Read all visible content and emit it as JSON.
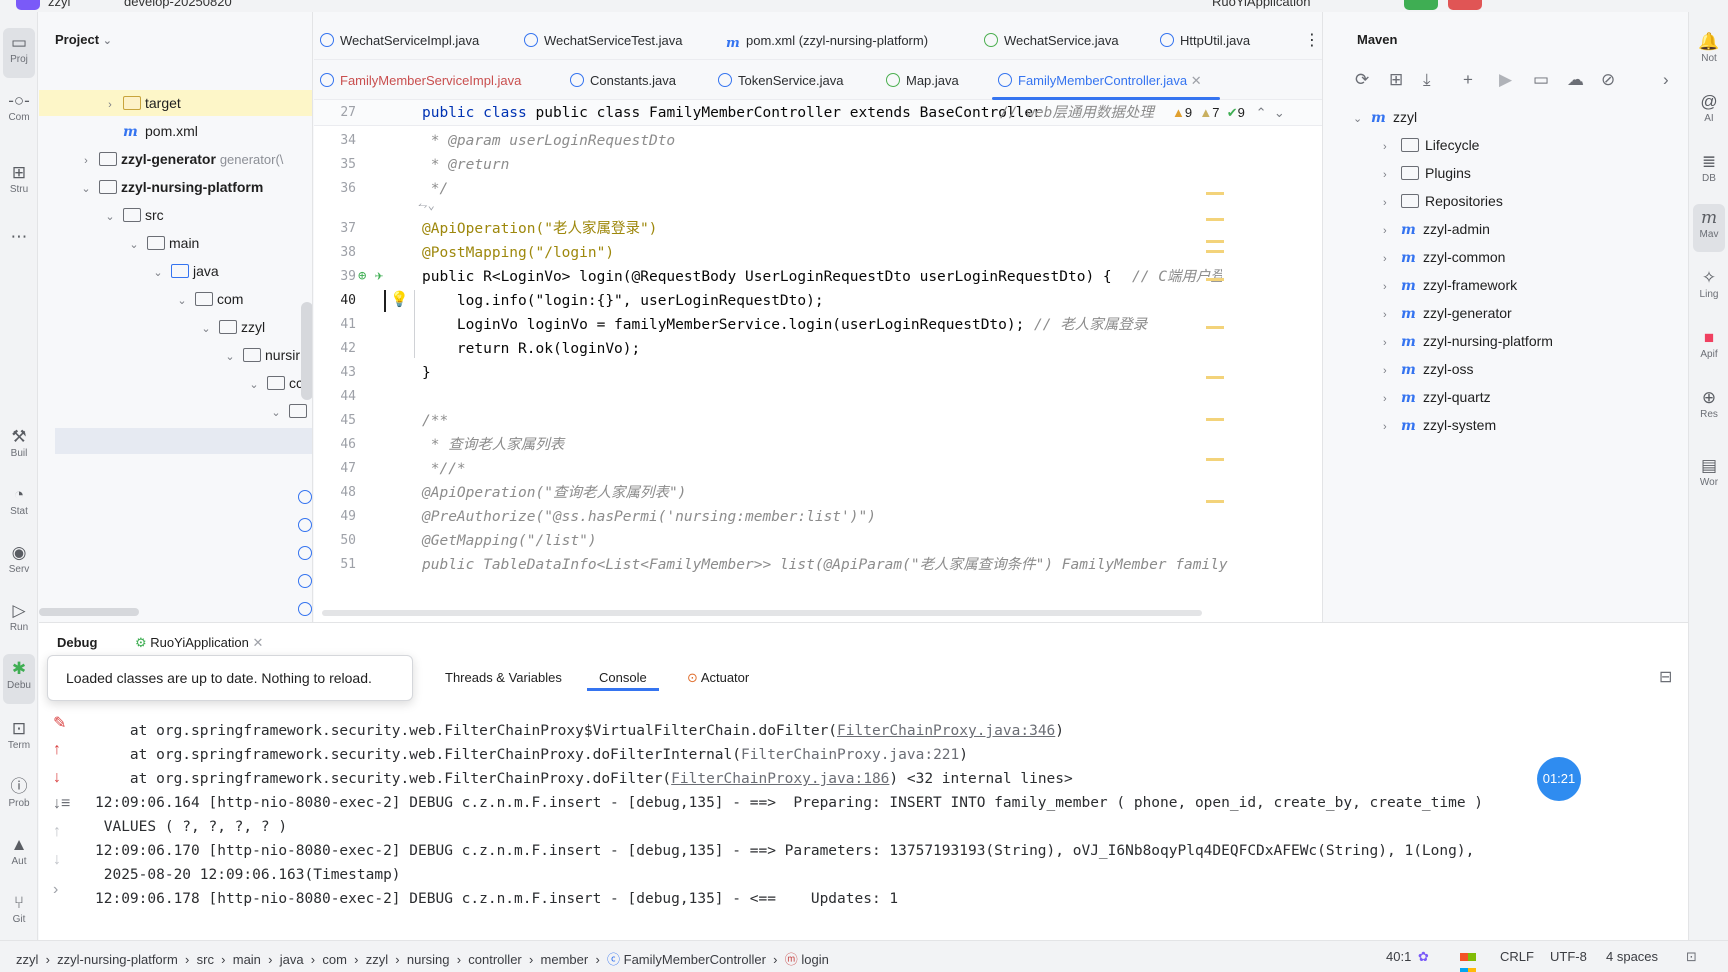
{
  "titlebar": {
    "project": "zzyl",
    "branch": "develop-20250820",
    "run_config": "RuoYiApplication"
  },
  "left_toolbar": [
    {
      "label": "Proj",
      "icon": "folder-icon"
    },
    {
      "label": "Com",
      "icon": "commit-icon"
    },
    {
      "label": "Stru",
      "icon": "structure-icon"
    },
    {
      "label": "Buil",
      "icon": "hammer-icon"
    },
    {
      "label": "Stat",
      "icon": "statistic-icon"
    },
    {
      "label": "Serv",
      "icon": "services-icon"
    },
    {
      "label": "Run",
      "icon": "run-icon"
    },
    {
      "label": "Debu",
      "icon": "bug-icon"
    },
    {
      "label": "Term",
      "icon": "terminal-icon"
    },
    {
      "label": "Prob",
      "icon": "problems-icon"
    },
    {
      "label": "Aut",
      "icon": "alert-icon"
    },
    {
      "label": "Git",
      "icon": "git-icon"
    }
  ],
  "right_toolbar": [
    {
      "label": "Not",
      "icon": "bell-icon"
    },
    {
      "label": "AI",
      "icon": "ai-icon"
    },
    {
      "label": "DB",
      "icon": "database-icon"
    },
    {
      "label": "Mav",
      "icon": "maven-icon"
    },
    {
      "label": "Ling",
      "icon": "lingma-icon"
    },
    {
      "label": "Apif",
      "icon": "apifox-icon"
    },
    {
      "label": "Res",
      "icon": "globe-icon"
    },
    {
      "label": "Wor",
      "icon": "word-icon"
    }
  ],
  "project_panel": {
    "title": "Project",
    "tree": [
      {
        "name": "target",
        "extra": ""
      },
      {
        "name": "pom.xml",
        "extra": ""
      },
      {
        "name": "zzyl-generator",
        "extra": "generator(\\"
      },
      {
        "name": "zzyl-nursing-platform",
        "extra": ""
      },
      {
        "name": "src",
        "extra": ""
      },
      {
        "name": "main",
        "extra": ""
      },
      {
        "name": "java",
        "extra": ""
      },
      {
        "name": "com",
        "extra": ""
      },
      {
        "name": "zzyl",
        "extra": ""
      },
      {
        "name": "nursir",
        "extra": ""
      },
      {
        "name": "cc",
        "extra": ""
      }
    ]
  },
  "editor_tabs_row1": [
    {
      "label": "WechatServiceImpl.java"
    },
    {
      "label": "WechatServiceTest.java"
    },
    {
      "label": "pom.xml (zzyl-nursing-platform)"
    },
    {
      "label": "WechatService.java"
    },
    {
      "label": "HttpUtil.java"
    }
  ],
  "editor_tabs_row2": [
    {
      "label": "FamilyMemberServiceImpl.java"
    },
    {
      "label": "Constants.java"
    },
    {
      "label": "TokenService.java"
    },
    {
      "label": "Map.java"
    },
    {
      "label": "FamilyMemberController.java"
    }
  ],
  "editor": {
    "sticky_line": {
      "num": "27",
      "text": "public class FamilyMemberController extends BaseController",
      "comment": "// web层通用数据处理"
    },
    "inspections": {
      "warnings": "9",
      "weak_warnings": "7",
      "ok": "9"
    },
    "lines": [
      {
        "num": "34",
        "text": " * @param userLoginRequestDto"
      },
      {
        "num": "35",
        "text": " * @return"
      },
      {
        "num": "36",
        "text": " */"
      },
      {
        "num": "37",
        "text": "@ApiOperation(\"老人家属登录\")"
      },
      {
        "num": "38",
        "text": "@PostMapping(\"/login\")"
      },
      {
        "num": "39",
        "text": "public R<LoginVo> login(@RequestBody UserLoginRequestDto userLoginRequestDto) {",
        "comment": "// C端用户登录"
      },
      {
        "num": "40",
        "text": "    log.info(\"login:{}\", userLoginRequestDto);"
      },
      {
        "num": "41",
        "text": "    LoginVo loginVo = familyMemberService.login(userLoginRequestDto);",
        "comment": "// 老人家属登录"
      },
      {
        "num": "42",
        "text": "    return R.ok(loginVo);"
      },
      {
        "num": "43",
        "text": "}"
      },
      {
        "num": "44",
        "text": ""
      },
      {
        "num": "45",
        "text": "/**"
      },
      {
        "num": "46",
        "text": " * 查询老人家属列表"
      },
      {
        "num": "47",
        "text": " *//*"
      },
      {
        "num": "48",
        "text": "@ApiOperation(\"查询老人家属列表\")"
      },
      {
        "num": "49",
        "text": "@PreAuthorize(\"@ss.hasPermi('nursing:member:list')\")"
      },
      {
        "num": "50",
        "text": "@GetMapping(\"/list\")"
      },
      {
        "num": "51",
        "text": "public TableDataInfo<List<FamilyMember>> list(@ApiParam(\"老人家属查询条件\") FamilyMember family"
      }
    ]
  },
  "maven_panel": {
    "title": "Maven",
    "root": "zzyl",
    "items": [
      {
        "name": "Lifecycle"
      },
      {
        "name": "Plugins"
      },
      {
        "name": "Repositories"
      },
      {
        "name": "zzyl-admin"
      },
      {
        "name": "zzyl-common"
      },
      {
        "name": "zzyl-framework"
      },
      {
        "name": "zzyl-generator"
      },
      {
        "name": "zzyl-nursing-platform"
      },
      {
        "name": "zzyl-oss"
      },
      {
        "name": "zzyl-quartz"
      },
      {
        "name": "zzyl-system"
      }
    ]
  },
  "debug_panel": {
    "title": "Debug",
    "session": "RuoYiApplication",
    "tooltip": "Loaded classes are up to date. Nothing to reload.",
    "tabs": [
      {
        "label": "Threads & Variables"
      },
      {
        "label": "Console"
      },
      {
        "label": "Actuator"
      }
    ],
    "timer": "01:21",
    "log_lines": [
      {
        "pre": "    at org.springframework.security.web.FilterChainProxy$VirtualFilterChain.doFilter(",
        "link": "FilterChainProxy.java:346",
        "post": ")"
      },
      {
        "pre": "    at org.springframework.security.web.FilterChainProxy.doFilterInternal(",
        "link": "FilterChainProxy.java:221",
        "post": ")"
      },
      {
        "pre": "    at org.springframework.security.web.FilterChainProxy.doFilter(",
        "link": "FilterChainProxy.java:186",
        "post": ") <32 internal lines>"
      },
      {
        "pre": "12:09:06.164 [http-nio-8080-exec-2] DEBUG c.z.n.m.F.insert - [debug,135] - ==>  Preparing: INSERT INTO family_member ( phone, open_id, create_by, create_time )",
        "link": "",
        "post": ""
      },
      {
        "pre": " VALUES ( ?, ?, ?, ? )",
        "link": "",
        "post": ""
      },
      {
        "pre": "12:09:06.170 [http-nio-8080-exec-2] DEBUG c.z.n.m.F.insert - [debug,135] - ==> Parameters: 13757193193(String), oVJ_I6Nb8oqyPlq4DEQFCDxAFEWc(String), 1(Long),",
        "link": "",
        "post": ""
      },
      {
        "pre": " 2025-08-20 12:09:06.163(Timestamp)",
        "link": "",
        "post": ""
      },
      {
        "pre": "12:09:06.178 [http-nio-8080-exec-2] DEBUG c.z.n.m.F.insert - [debug,135] - <==    Updates: 1",
        "link": "",
        "post": ""
      }
    ]
  },
  "statusbar": {
    "breadcrumbs": [
      "zzyl",
      "zzyl-nursing-platform",
      "src",
      "main",
      "java",
      "com",
      "zzyl",
      "nursing",
      "controller",
      "member",
      "FamilyMemberController",
      "login"
    ],
    "position": "40:1",
    "line_ending": "CRLF",
    "encoding": "UTF-8",
    "indent": "4 spaces"
  }
}
